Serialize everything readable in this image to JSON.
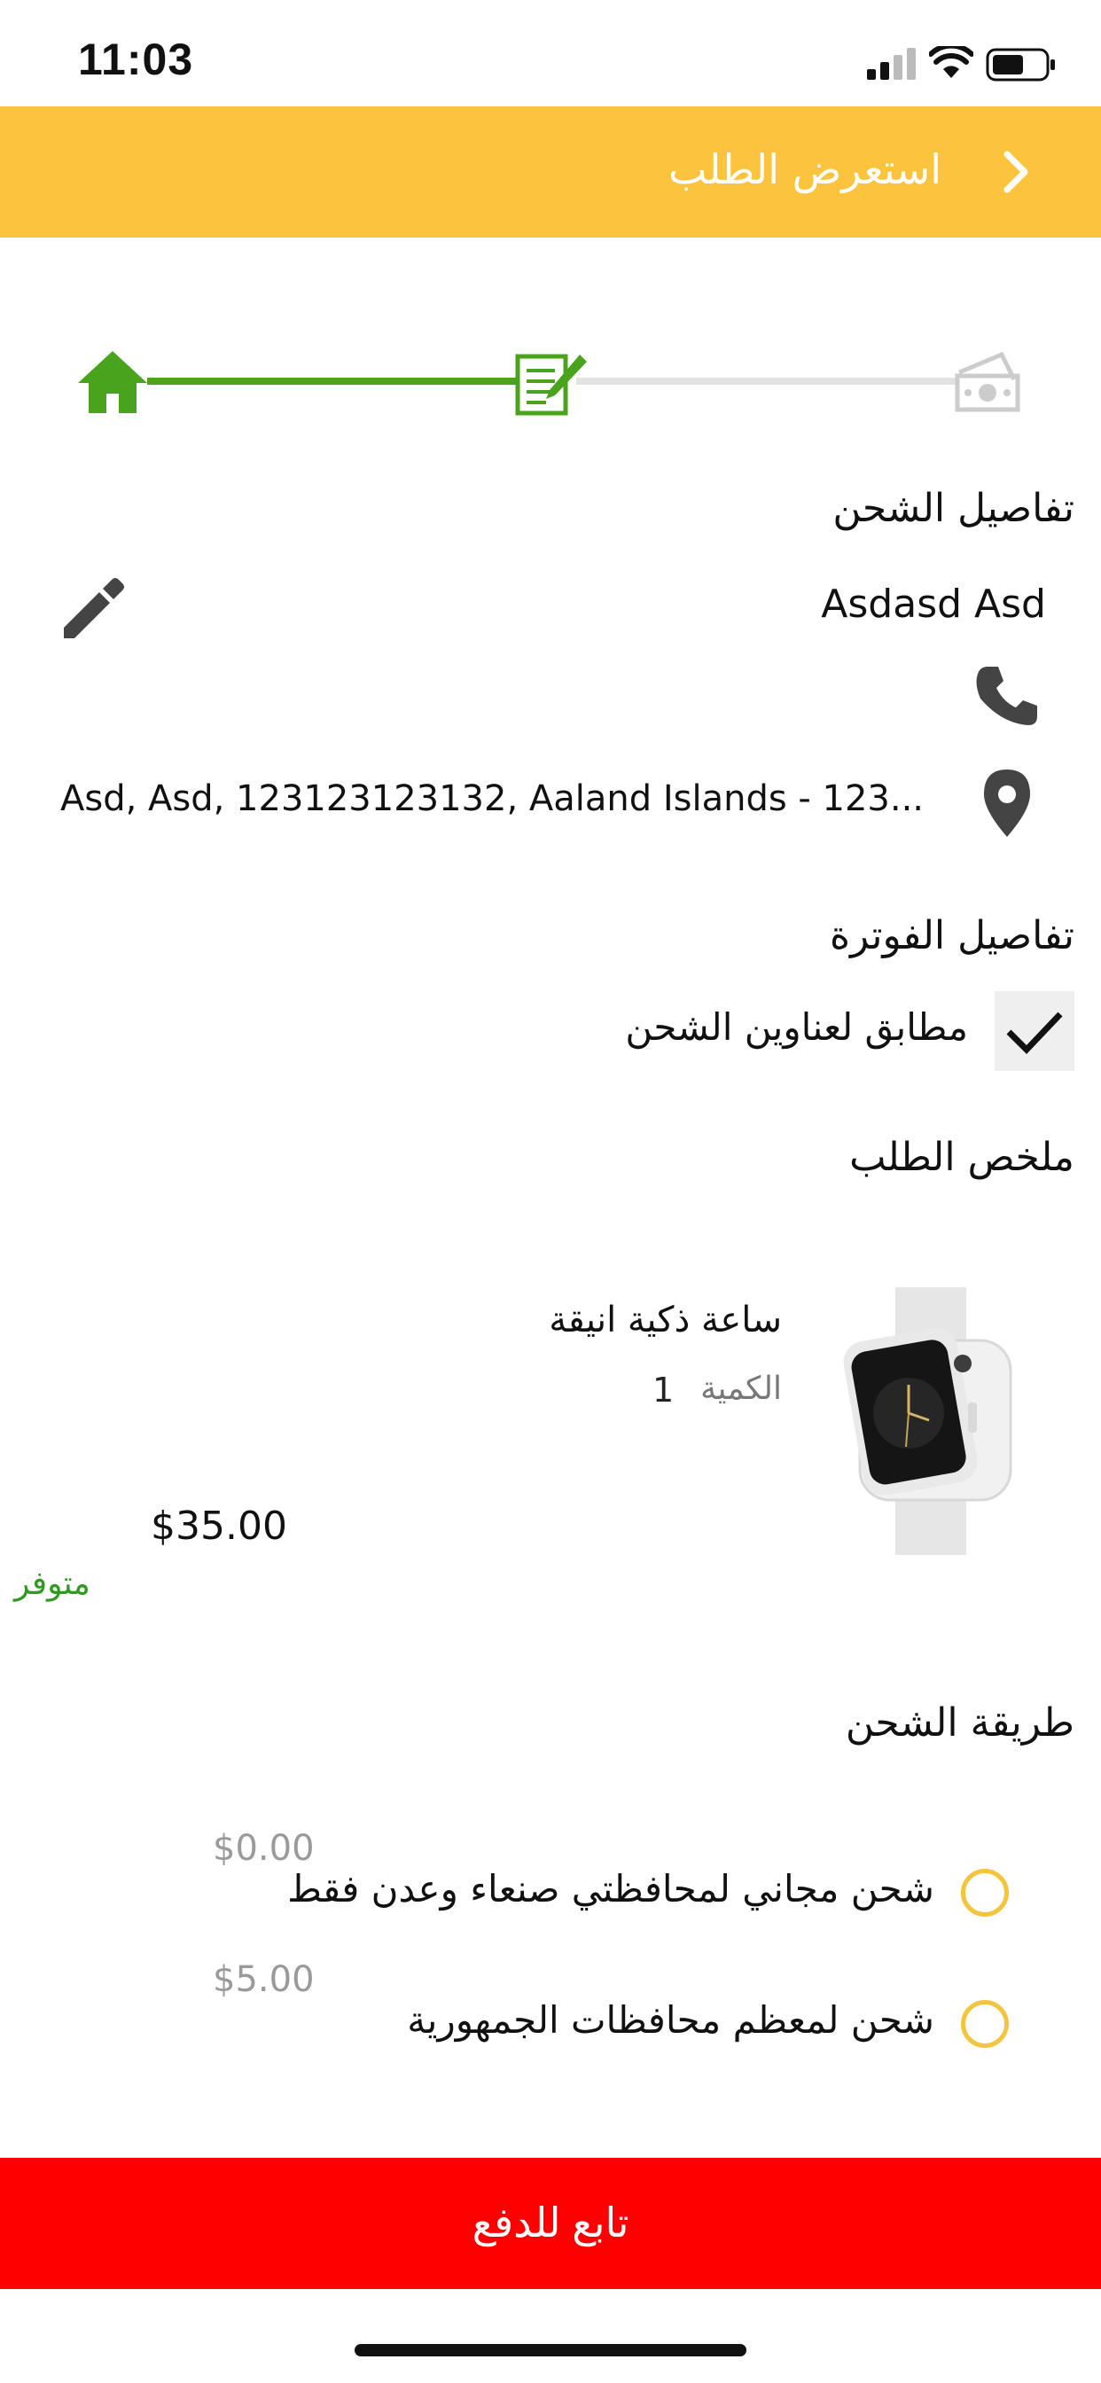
{
  "status_bar": {
    "time": "11:03"
  },
  "header": {
    "title": "استعرض الطلب"
  },
  "steps": [
    "home-icon",
    "edit-icon",
    "payment-icon"
  ],
  "shipping_details": {
    "title": "تفاصيل الشحن",
    "name": "Asdasd Asd",
    "address": "Asd, Asd, 123123123132, Aaland Islands - 123..."
  },
  "billing_details": {
    "title": "تفاصيل الفوترة",
    "same_as_shipping_label": "مطابق لعناوين الشحن"
  },
  "order_summary": {
    "title": "ملخص الطلب",
    "item": {
      "name": "ساعة ذكية انيقة",
      "quantity_label": "الكمية",
      "quantity": "1",
      "price": "$35.00",
      "stock": "متوفر"
    }
  },
  "shipping_method": {
    "title": "طريقة الشحن",
    "options": [
      {
        "label": "شحن مجاني لمحافظتي صنعاء وعدن فقط",
        "price": "$0.00"
      },
      {
        "label": "شحن لمعظم محافظات الجمهورية",
        "price": "$5.00"
      }
    ]
  },
  "checkout_button": {
    "label": "تابع للدفع"
  },
  "colors": {
    "header": "#fcc43d",
    "accent_green": "#4aa31c",
    "button": "#ff0000",
    "radio": "#f3c53f"
  }
}
